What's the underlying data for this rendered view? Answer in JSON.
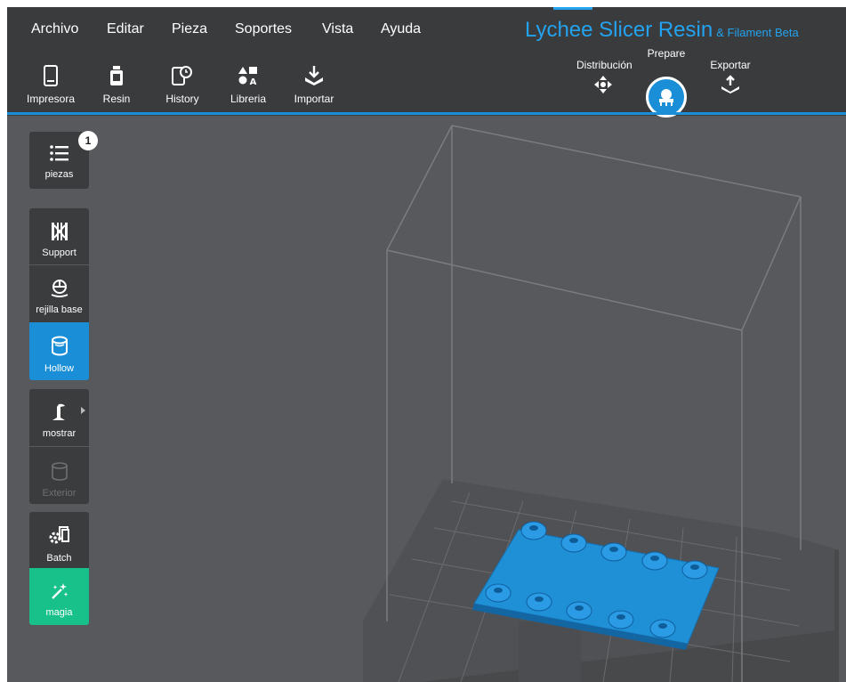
{
  "menu": {
    "archivo": "Archivo",
    "editar": "Editar",
    "pieza": "Pieza",
    "soportes": "Soportes",
    "vista": "Vista",
    "ayuda": "Ayuda"
  },
  "app": {
    "title": "Lychee Slicer Resin",
    "subtitle": "& Filament Beta",
    "accent_color": "#23a3ef"
  },
  "toolbar": {
    "impresora": "Impresora",
    "resin": "Resin",
    "history": "History",
    "libreria": "Libreria",
    "importar": "Importar"
  },
  "modes": {
    "distribucion": "Distribución",
    "prepare": "Prepare",
    "exportar": "Exportar",
    "active": "Prepare"
  },
  "panel": {
    "piezas": "piezas",
    "piezas_count": "1",
    "support": "Support",
    "rejilla_base": "rejilla base",
    "hollow": "Hollow",
    "mostrar": "mostrar",
    "exterior": "Exterior",
    "batch": "Batch",
    "magia": "magia"
  },
  "colors": {
    "active": "#1a8fd8",
    "magic": "#18c08a",
    "model": "#1f8fd6",
    "viewport": "#58595c",
    "topbar": "#3a3b3d"
  },
  "icons": [
    "printer-icon",
    "resin-bottle-icon",
    "history-icon",
    "library-icon",
    "import-icon",
    "move-arrows-icon",
    "prepare-icon",
    "export-icon",
    "list-icon",
    "support-icon",
    "raft-icon",
    "hollow-icon",
    "display-icon",
    "exterior-icon",
    "batch-icon",
    "magic-wand-icon"
  ]
}
